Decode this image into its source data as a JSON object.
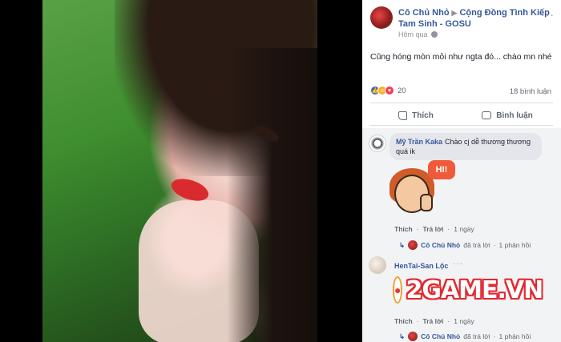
{
  "post": {
    "author": "Cô Chủ Nhỏ",
    "group": "Cộng Đồng Tình Kiếp Tam Sinh - GOSU",
    "time": "Hôm qua",
    "text": "Cũng hóng mòn mỏi như ngta đó... chào mn nhé",
    "reaction_count": "20",
    "comment_count": "18 bình luận",
    "like_label": "Thích",
    "comment_label": "Bình luận"
  },
  "comments": [
    {
      "name": "Mỹ Trần Kaka",
      "text": "Chào cj dễ thương thương quá ik",
      "like": "Thích",
      "reply": "Trả lời",
      "time": "1 ngày",
      "reply_summary_author": "Cô Chủ Nhỏ",
      "reply_summary_text": "đã trả lời",
      "reply_summary_count": "1 phản hồi",
      "sticker_text": "HI!"
    },
    {
      "name": "HenTai-San Lộc",
      "like": "Thích",
      "reply": "Trả lời",
      "time": "1 ngày",
      "reply_summary_author": "Cô Chủ Nhỏ",
      "reply_summary_text": "đã trả lời",
      "reply_summary_count": "1 phản hồi"
    }
  ],
  "watermark": "2GAME.VN",
  "colors": {
    "link": "#385898",
    "accent": "#4267b2",
    "watermark": "#e2292f"
  }
}
